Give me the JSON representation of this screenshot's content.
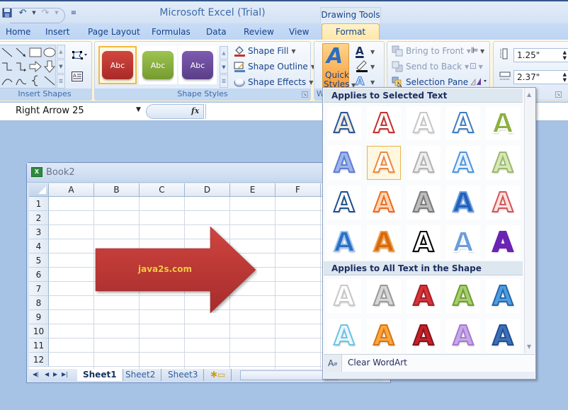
{
  "window": {
    "title": "Microsoft Excel (Trial)",
    "contextual_tab_group": "Drawing Tools"
  },
  "quick_access": {
    "save_icon": "save-icon",
    "undo_icon": "undo-icon",
    "redo_icon": "redo-icon",
    "customize_icon": "customize-qat-icon"
  },
  "tabs": [
    {
      "label": "Home"
    },
    {
      "label": "Insert"
    },
    {
      "label": "Page Layout"
    },
    {
      "label": "Formulas"
    },
    {
      "label": "Data"
    },
    {
      "label": "Review"
    },
    {
      "label": "View"
    },
    {
      "label": "Format",
      "active": true
    }
  ],
  "ribbon": {
    "insert_shapes": {
      "label": "Insert Shapes",
      "shapes": [
        "line",
        "arrow",
        "rectangle",
        "oval",
        "elbow-connector",
        "elbow-arrow-connector",
        "right-arrow",
        "down-arrow",
        "arc",
        "curve",
        "left-brace",
        "line"
      ]
    },
    "shape_styles": {
      "label": "Shape Styles",
      "thumbnails": [
        {
          "text": "Abc",
          "color": "#b8312f",
          "selected": true
        },
        {
          "text": "Abc",
          "color": "#86ad3c",
          "selected": false
        },
        {
          "text": "Abc",
          "color": "#6a4c98",
          "selected": false
        }
      ],
      "shape_fill": "Shape Fill",
      "shape_outline": "Shape Outline",
      "shape_effects": "Shape Effects"
    },
    "wordart": {
      "label": "W",
      "quick_styles_line1": "Quick",
      "quick_styles_line2": "Styles"
    },
    "arrange": {
      "bring_to_front": "Bring to Front",
      "send_to_back": "Send to Back",
      "selection_pane": "Selection Pane"
    },
    "size": {
      "height": "1.25\"",
      "width": "2.37\""
    }
  },
  "formula_bar": {
    "name_box": "Right Arrow 25",
    "fx_label": "fx",
    "formula": ""
  },
  "workbook": {
    "title": "Book2",
    "columns": [
      "A",
      "B",
      "C",
      "D",
      "E",
      "F"
    ],
    "rows": [
      "1",
      "2",
      "3",
      "4",
      "5",
      "6",
      "7",
      "8",
      "9",
      "10",
      "11",
      "12"
    ],
    "sheets": [
      {
        "label": "Sheet1",
        "active": true
      },
      {
        "label": "Sheet2",
        "active": false
      },
      {
        "label": "Sheet3",
        "active": false
      }
    ],
    "shape": {
      "type": "Right Arrow",
      "text": "java2s.com",
      "fill": "#c0393a",
      "text_color": "#f6c552"
    }
  },
  "quick_styles_popup": {
    "section1_label": "Applies to Selected Text",
    "section2_label": "Applies to All Text in the Shape",
    "section1_styles": [
      {
        "fill": "#f1ece0",
        "stroke": "#2a5597"
      },
      {
        "fill": "#ffffff",
        "stroke": "#c3302f"
      },
      {
        "fill": "#ffffff",
        "stroke": "#c7c7c7"
      },
      {
        "fill": "#ffffff",
        "stroke": "#3f7ec1"
      },
      {
        "fill": "#8db040",
        "stroke": "#ffffff"
      },
      {
        "fill": "#9eb5ea",
        "stroke": "#5d7ed4"
      },
      {
        "fill": "#ffffff",
        "stroke": "#ee8a3d",
        "selected": true
      },
      {
        "fill": "#eeeeee",
        "stroke": "#b3b3b3"
      },
      {
        "fill": "#e6f2fd",
        "stroke": "#4f95dd"
      },
      {
        "fill": "#d6e8b5",
        "stroke": "#9db86e"
      },
      {
        "fill": "#ffffff",
        "stroke": "#1d4f8f"
      },
      {
        "fill": "#ffd5b5",
        "stroke": "#ec6b1d"
      },
      {
        "fill": "#bdbdbd",
        "stroke": "#7a7a7a"
      },
      {
        "fill": "#2460b7",
        "stroke": "#6aa0e0"
      },
      {
        "fill": "#fbe1e1",
        "stroke": "#d55454"
      },
      {
        "fill": "#2d6fc3",
        "stroke": "#9cc7f2"
      },
      {
        "fill": "#d8680d",
        "stroke": "#f0a04a"
      },
      {
        "fill": "#ffffff",
        "stroke": "#000000"
      },
      {
        "fill": "#6a9ddc",
        "stroke": "#ffffff"
      },
      {
        "fill": "#6b23b3",
        "stroke": "#6b23b3"
      }
    ],
    "section2_styles": [
      {
        "fill": "#ffffff",
        "stroke": "#c8c8c8"
      },
      {
        "fill": "#d6d6d6",
        "stroke": "#9a9a9a"
      },
      {
        "fill": "#d8333a",
        "stroke": "#a52026"
      },
      {
        "fill": "#a6cf6b",
        "stroke": "#6f9d35"
      },
      {
        "fill": "#4e9de0",
        "stroke": "#2367ae"
      },
      {
        "fill": "#eaf8ff",
        "stroke": "#6cc3e5"
      },
      {
        "fill": "#fba640",
        "stroke": "#d6760f"
      },
      {
        "fill": "#c52129",
        "stroke": "#851318"
      },
      {
        "fill": "#c9a6e8",
        "stroke": "#a17bd1"
      },
      {
        "fill": "#3c70b9",
        "stroke": "#1f4f94"
      }
    ],
    "clear_label": "Clear WordArt"
  }
}
